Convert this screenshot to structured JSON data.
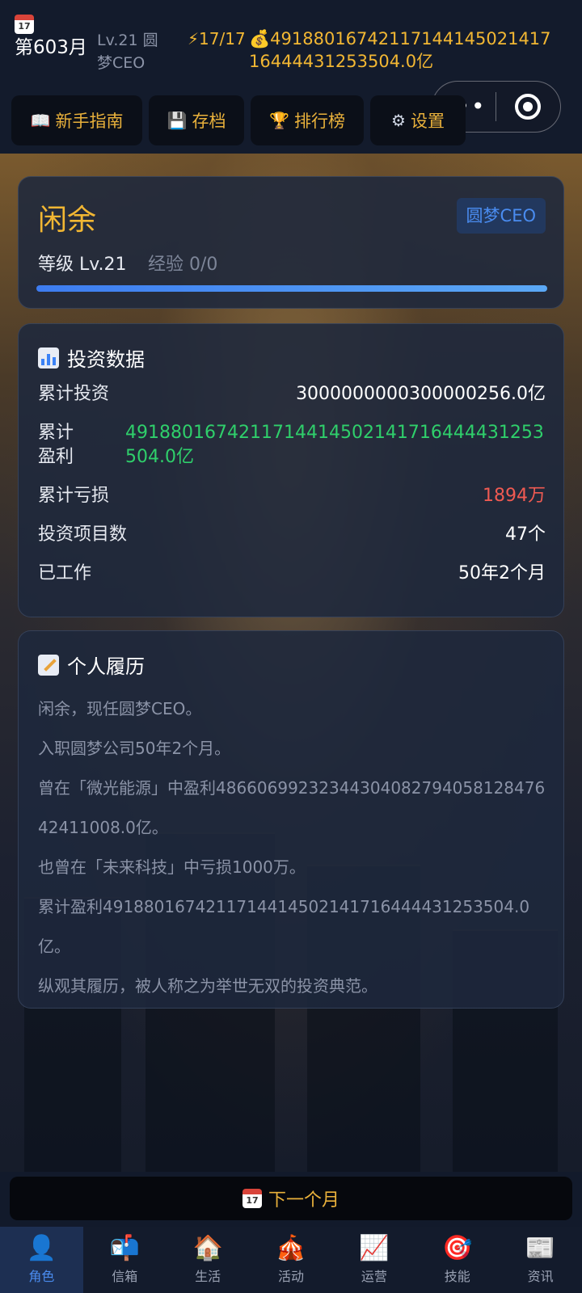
{
  "header": {
    "day_icon_text": "17",
    "day_label": "第603月",
    "level_title": "Lv.21 圆梦CEO",
    "energy": "⚡17/17",
    "money": "💰4918801674211714414502141716444431253504.0亿"
  },
  "capsule": {
    "more": "•••"
  },
  "toolbar": {
    "guide": "新手指南",
    "save": "存档",
    "rank": "排行榜",
    "settings": "设置"
  },
  "profile": {
    "name": "闲余",
    "title_badge": "圆梦CEO",
    "level": "等级 Lv.21",
    "exp": "经验 0/0",
    "exp_progress": 1.0
  },
  "invest": {
    "title": "投资数据",
    "rows": [
      {
        "k": "累计投资",
        "v": "3000000000300000256.0亿"
      },
      {
        "k": "累计\n盈利",
        "v": "4918801674211714414502141716444431253504.0亿"
      },
      {
        "k": "累计亏损",
        "v": "1894万"
      },
      {
        "k": "投资项目数",
        "v": "47个"
      },
      {
        "k": "已工作",
        "v": "50年2个月"
      }
    ]
  },
  "resume": {
    "title": "个人履历",
    "lines": [
      "闲余，现任圆梦CEO。",
      "入职圆梦公司50年2个月。",
      "曾在「微光能源」中盈利4866069923234430408279405812847642411008.0亿。",
      "也曾在「未来科技」中亏损1000万。",
      "累计盈利4918801674211714414502141716444431253504.0亿。",
      "纵观其履历，被人称之为举世无双的投资典范。"
    ]
  },
  "next_month": {
    "icon_text": "17",
    "label": "下一个月"
  },
  "tabs": [
    {
      "icon": "👤",
      "label": "角色"
    },
    {
      "icon": "📬",
      "label": "信箱"
    },
    {
      "icon": "🏠",
      "label": "生活"
    },
    {
      "icon": "🎪",
      "label": "活动"
    },
    {
      "icon": "📈",
      "label": "运营"
    },
    {
      "icon": "🎯",
      "label": "技能"
    },
    {
      "icon": "📰",
      "label": "资讯"
    }
  ],
  "colors": {
    "accent_gold": "#f2b733",
    "accent_blue": "#4a8cf0",
    "profit_green": "#2fcf6b",
    "loss_red": "#ef5a52"
  }
}
